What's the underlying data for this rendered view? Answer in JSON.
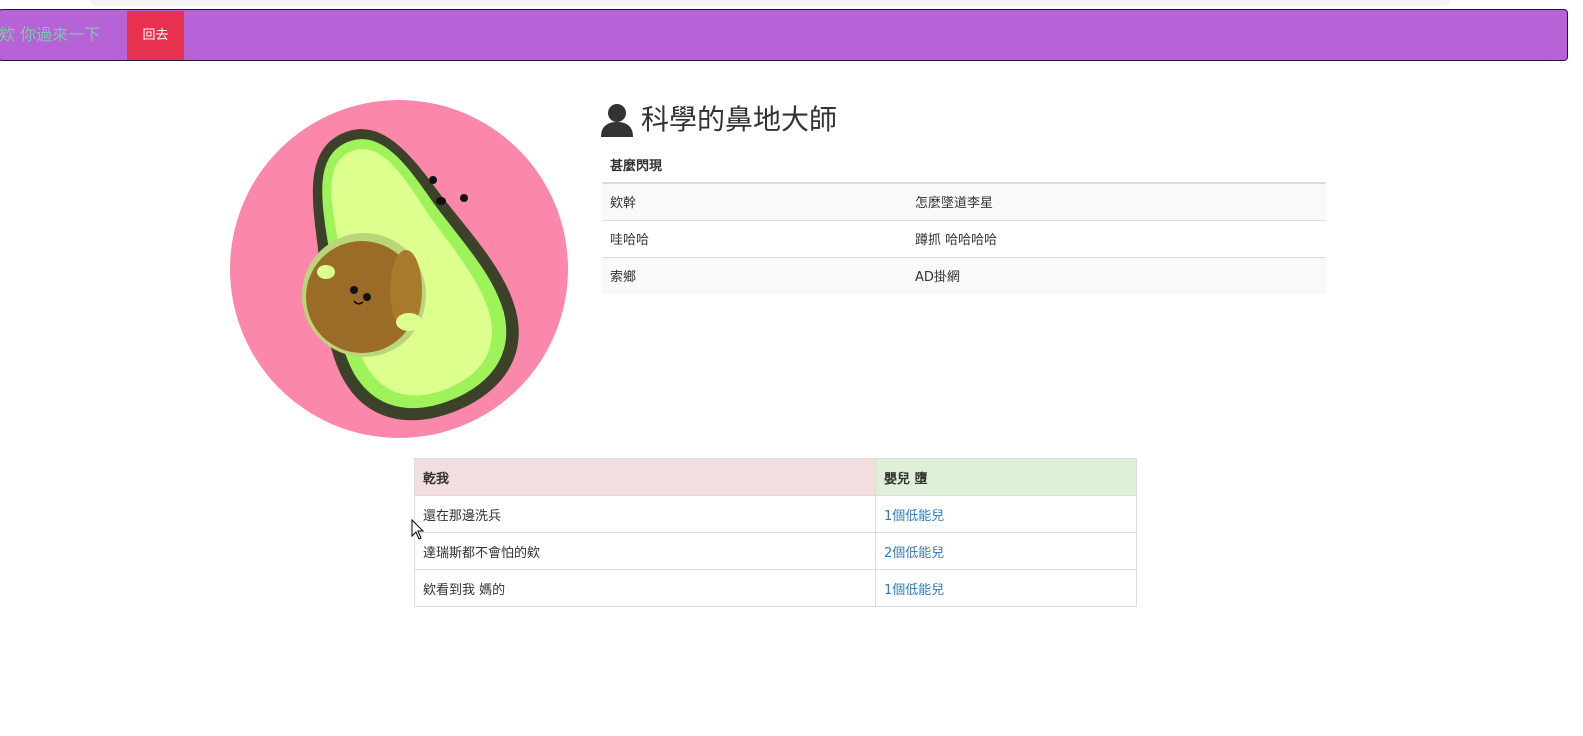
{
  "navbar": {
    "brand": "欸 你過來一下",
    "back_button": "回去",
    "color": "#b762d6",
    "back_color": "#e8314e"
  },
  "profile": {
    "icon": "user-icon",
    "name": "科學的鼻地大師",
    "avatar": "avocado-illustration",
    "table": {
      "header": "甚麼閃現",
      "rows": [
        {
          "label": "欸幹",
          "value": "怎麼墜道李星"
        },
        {
          "label": "哇哈哈",
          "value": "蹲抓 哈哈哈哈"
        },
        {
          "label": "索鄉",
          "value": "AD掛網"
        }
      ]
    }
  },
  "list": {
    "headers": [
      "乾我",
      "嬰兒 墮"
    ],
    "rows": [
      {
        "text": "還在那邊洗兵",
        "link": "1個低能兒"
      },
      {
        "text": "達瑞斯都不會怕的欸",
        "link": "2個低能兒"
      },
      {
        "text": "欸看到我 媽的",
        "link": "1個低能兒"
      }
    ]
  }
}
